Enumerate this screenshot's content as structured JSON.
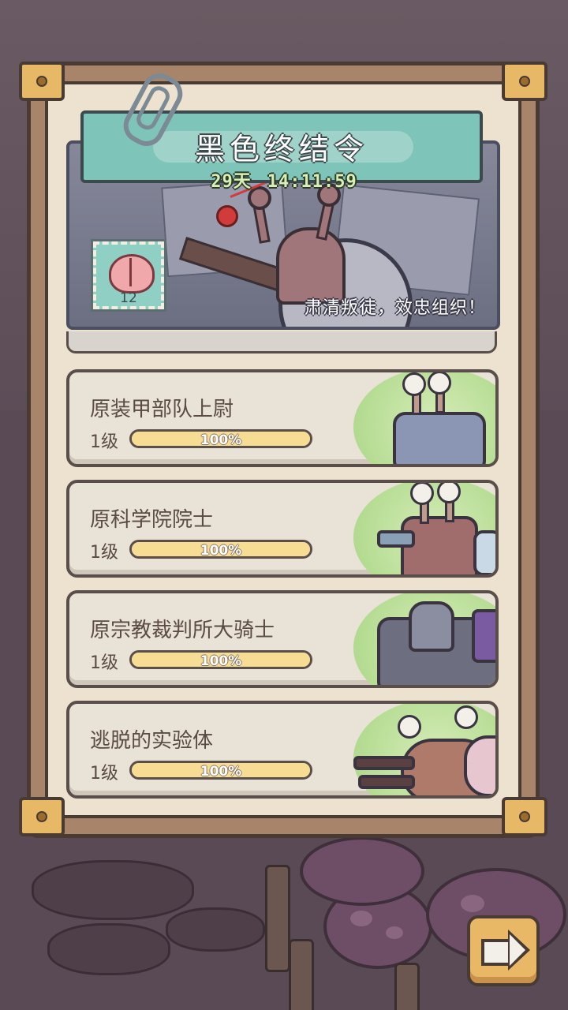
{
  "event": {
    "title": "黑色终结令",
    "timer_days": "29天",
    "timer_clock": "14:11:59",
    "slogan": "肃清叛徒，效忠组织！",
    "reward_icon": "brain-icon",
    "reward_count": "12"
  },
  "characters": [
    {
      "name": "原装甲部队上尉",
      "level": "1级",
      "progress_text": "100%",
      "progress": 1.0,
      "portrait_icon": "armored-snail-portrait"
    },
    {
      "name": "原科学院院士",
      "level": "1级",
      "progress_text": "100%",
      "progress": 1.0,
      "portrait_icon": "scientist-snail-portrait"
    },
    {
      "name": "原宗教裁判所大骑士",
      "level": "1级",
      "progress_text": "100%",
      "progress": 1.0,
      "portrait_icon": "knight-snail-portrait"
    },
    {
      "name": "逃脱的实验体",
      "level": "1级",
      "progress_text": "100%",
      "progress": 1.0,
      "portrait_icon": "experiment-snail-portrait"
    }
  ],
  "controls": {
    "next_icon": "arrow-right-icon"
  },
  "colors": {
    "panel_bg": "#ece2cf",
    "title_bar": "#7ec4b8",
    "progress_fill": "#f6dd93",
    "portrait_glow": "#b7dd95"
  }
}
